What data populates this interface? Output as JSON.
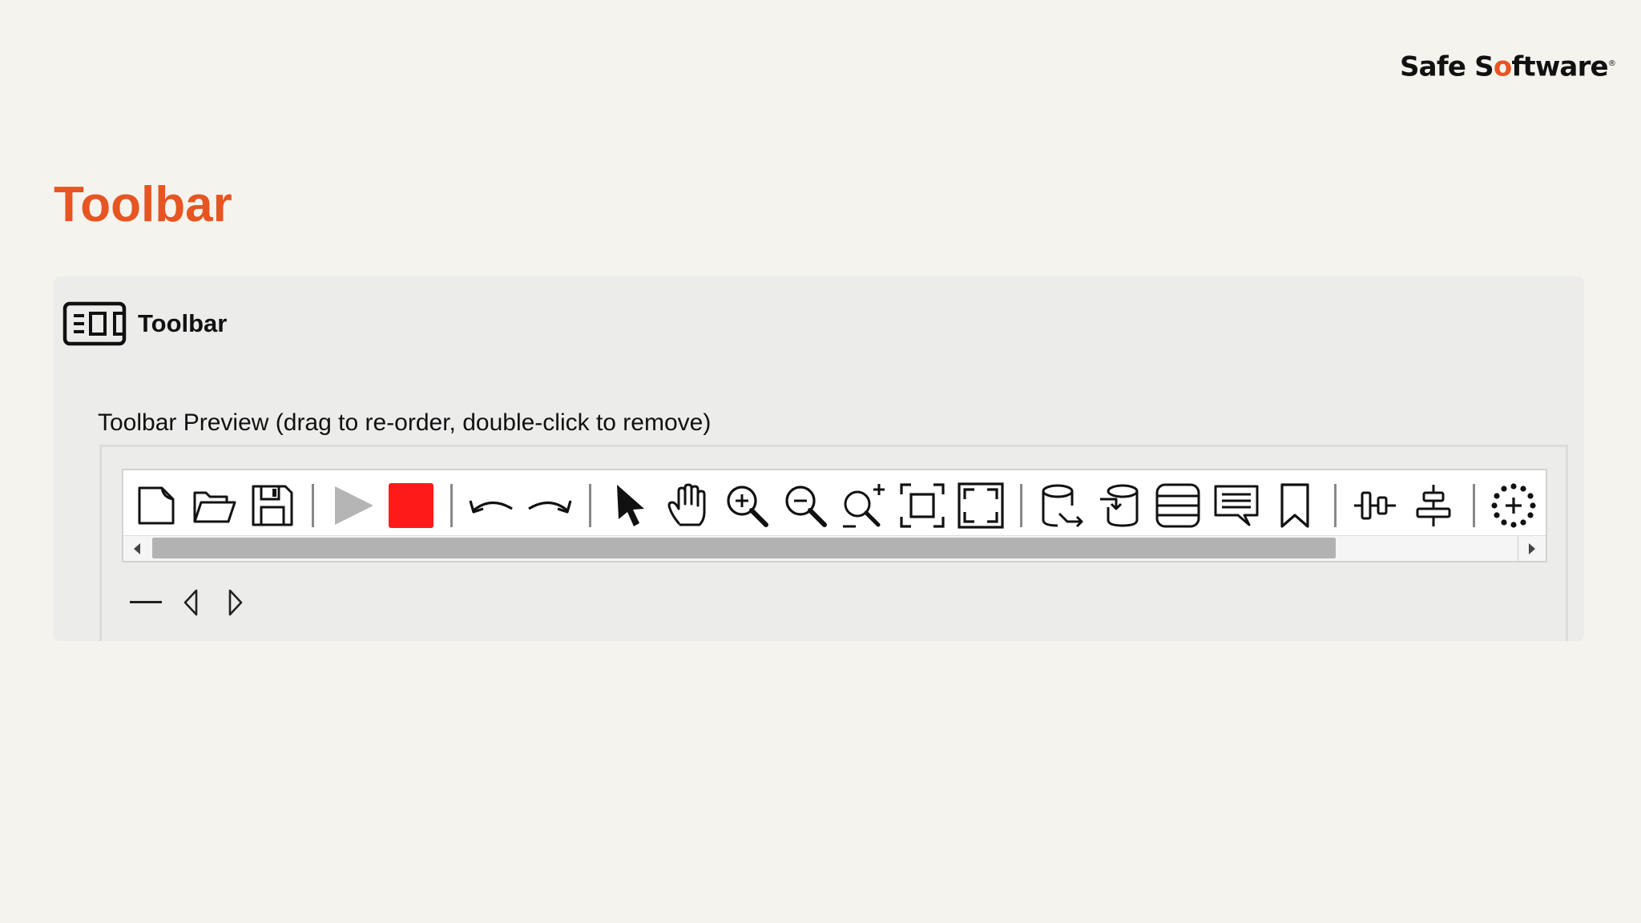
{
  "brand": {
    "logo_part1": "Safe S",
    "logo_dot": "o",
    "logo_part2": "ftware",
    "logo_mark": "®",
    "accent_color": "#e65522"
  },
  "slide": {
    "title": "Toolbar"
  },
  "panel": {
    "icon": "toolbar-icon",
    "title": "Toolbar",
    "preview_label": "Toolbar Preview (drag to re-order, double-click to remove)"
  },
  "toolbar_items": [
    {
      "icon": "new-file-icon"
    },
    {
      "icon": "open-folder-icon"
    },
    {
      "icon": "save-icon"
    },
    {
      "icon": "separator"
    },
    {
      "icon": "run-icon",
      "state": "disabled"
    },
    {
      "icon": "stop-icon",
      "color": "#ff1a1a"
    },
    {
      "icon": "separator"
    },
    {
      "icon": "undo-icon"
    },
    {
      "icon": "redo-icon"
    },
    {
      "icon": "separator"
    },
    {
      "icon": "select-pointer-icon"
    },
    {
      "icon": "pan-hand-icon"
    },
    {
      "icon": "zoom-in-icon"
    },
    {
      "icon": "zoom-out-icon"
    },
    {
      "icon": "zoom-adjust-icon"
    },
    {
      "icon": "zoom-to-selection-icon"
    },
    {
      "icon": "zoom-to-extents-icon"
    },
    {
      "icon": "separator"
    },
    {
      "icon": "add-reader-icon"
    },
    {
      "icon": "add-writer-icon"
    },
    {
      "icon": "feature-types-icon"
    },
    {
      "icon": "annotation-icon"
    },
    {
      "icon": "bookmark-icon"
    },
    {
      "icon": "separator"
    },
    {
      "icon": "align-horizontal-icon"
    },
    {
      "icon": "align-vertical-icon"
    },
    {
      "icon": "separator"
    },
    {
      "icon": "partial-run-icon"
    },
    {
      "icon": "overflow-icon"
    }
  ],
  "preview_controls": [
    {
      "icon": "separator-tool-icon"
    },
    {
      "icon": "move-left-icon"
    },
    {
      "icon": "move-right-icon"
    }
  ]
}
